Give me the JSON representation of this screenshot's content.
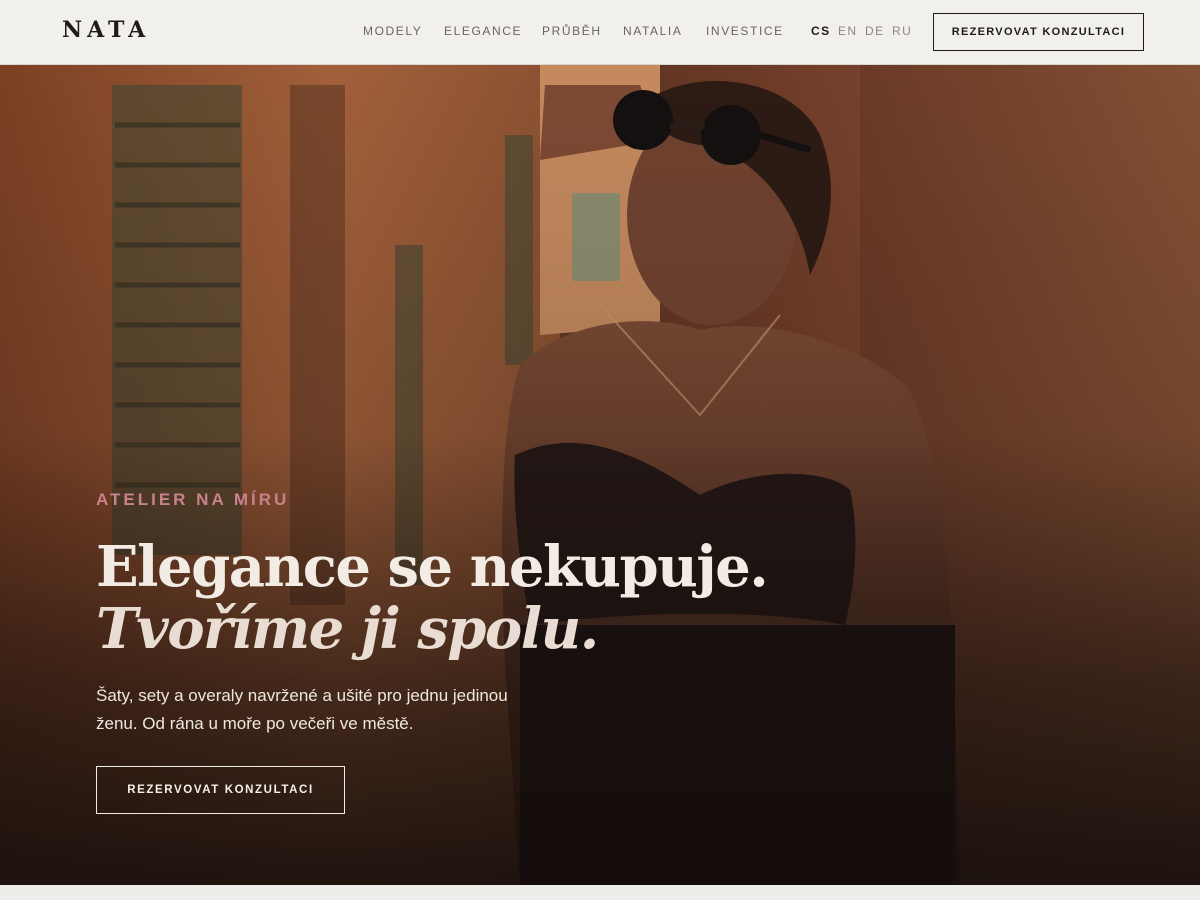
{
  "header": {
    "logo": "NATA",
    "nav": [
      "MODELY",
      "ELEGANCE",
      "PRŮBĚH",
      "NATALIA",
      "INVESTICE"
    ],
    "languages": [
      "CS",
      "EN",
      "DE",
      "RU"
    ],
    "active_language": "CS",
    "cta_label": "REZERVOVAT KONZULTACI"
  },
  "hero": {
    "eyebrow": "ATELIER NA MÍRU",
    "headline_line1": "Elegance se nekupuje.",
    "headline_line2": "Tvoříme ji spolu.",
    "lead": "Šaty, sety a overaly navržené a ušité pro jednu jedinou ženu. Od rána u moře po večeři ve městě.",
    "cta_label": "REZERVOVAT KONZULTACI",
    "image_alt": "Woman in sunglasses and a dark top standing in a narrow warm-toned street"
  },
  "colors": {
    "accent": "#c9828c",
    "header_bg": "#f1f0ed",
    "text_dark": "#1f1b19"
  }
}
